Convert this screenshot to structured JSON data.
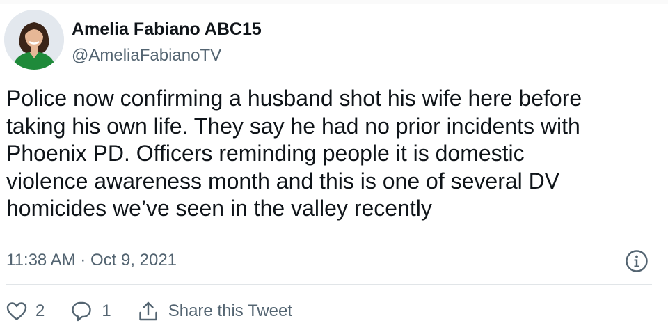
{
  "author": {
    "display_name": "Amelia Fabiano ABC15",
    "handle": "@AmeliaFabianoTV",
    "avatar_icon": "profile-photo"
  },
  "tweet": {
    "text_lines": [
      "Police now confirming a husband shot his wife here before",
      "taking his own life. They say he had no prior incidents with",
      "Phoenix PD. Officers reminding people it is domestic",
      "violence awareness month and this is one of several DV",
      "homicides we’ve seen in the valley recently"
    ],
    "timestamp": "11:38 AM · Oct 9, 2021"
  },
  "actions": {
    "like_icon": "heart-icon",
    "like_count": "2",
    "reply_icon": "speech-bubble-icon",
    "reply_count": "1",
    "share_icon": "share-upload-icon",
    "share_label": "Share this Tweet",
    "info_icon": "info-circle-icon"
  },
  "colors": {
    "text_primary": "#0f1419",
    "text_secondary": "#536471",
    "divider": "#e1e5e8",
    "avatar_dress": "#1f8a3a"
  }
}
